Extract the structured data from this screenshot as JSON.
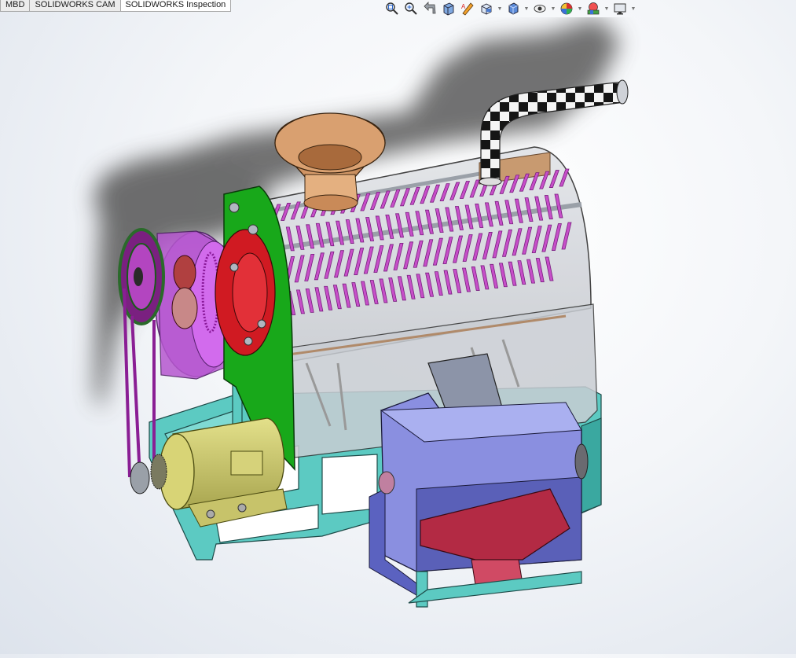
{
  "tabs": [
    {
      "label": "MBD"
    },
    {
      "label": "SOLIDWORKS CAM"
    },
    {
      "label": "SOLIDWORKS Inspection"
    }
  ],
  "hud_toolbar": {
    "icons": [
      "zoom-to-fit-icon",
      "zoom-to-area-icon",
      "previous-view-icon",
      "section-view-icon",
      "dynamic-annotation-icon",
      "view-orientation-icon",
      "display-style-icon",
      "hide-show-items-icon",
      "edit-appearance-icon",
      "apply-scene-icon",
      "view-settings-icon"
    ]
  },
  "colors": {
    "frame": "#58c8c0",
    "drum_spikes": "#c64fc8",
    "gear_housing": "#b85ad0",
    "side_plate": "#17a51a",
    "bearing_red": "#cc1020",
    "motor": "#c8c66a",
    "outlet_box": "#8e96e4",
    "chute": "#b0283e",
    "hopper": "#d89a68",
    "pipe_checker": "#111111"
  }
}
